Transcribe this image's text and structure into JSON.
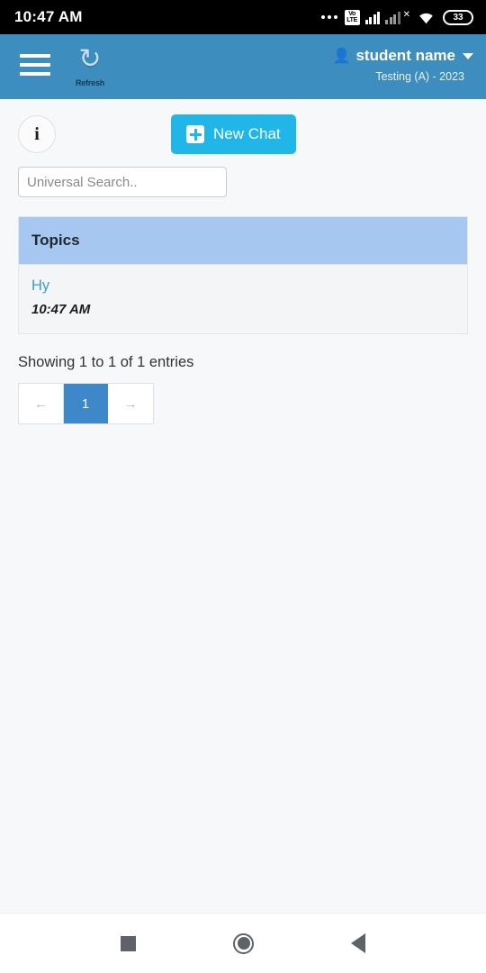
{
  "statusbar": {
    "clock": "10:47 AM",
    "volte_top": "Vo",
    "volte_bottom": "LTE",
    "battery": "33",
    "icons": [
      "more-dots",
      "volte-icon",
      "signal-icon",
      "signal-no-sim-icon",
      "wifi-icon",
      "battery-icon"
    ]
  },
  "appbar": {
    "menu_icon": "hamburger-menu-icon",
    "refresh_glyph": "↻",
    "refresh_label": "Refresh",
    "person_glyph": "👤",
    "user_name": "student name",
    "user_sub": "Testing (A) - 2023",
    "background_color": "#3d8dbf"
  },
  "toolbar": {
    "info_glyph": "i",
    "new_chat_label": "New Chat",
    "new_chat_color": "#20b6e8"
  },
  "search": {
    "placeholder": "Universal Search..",
    "value": ""
  },
  "table": {
    "header": "Topics",
    "header_color": "#a6c8f0",
    "rows": [
      {
        "topic": "Hy",
        "time": "10:47 AM"
      }
    ]
  },
  "pagination": {
    "entries_text": "Showing 1 to 1 of 1 entries",
    "prev_glyph": "←",
    "next_glyph": "→",
    "pages": [
      "1"
    ],
    "active_page": "1",
    "active_color": "#3e87c8"
  },
  "navbar": {
    "recents": "square-recents-icon",
    "home": "circle-home-icon",
    "back": "triangle-back-icon"
  }
}
